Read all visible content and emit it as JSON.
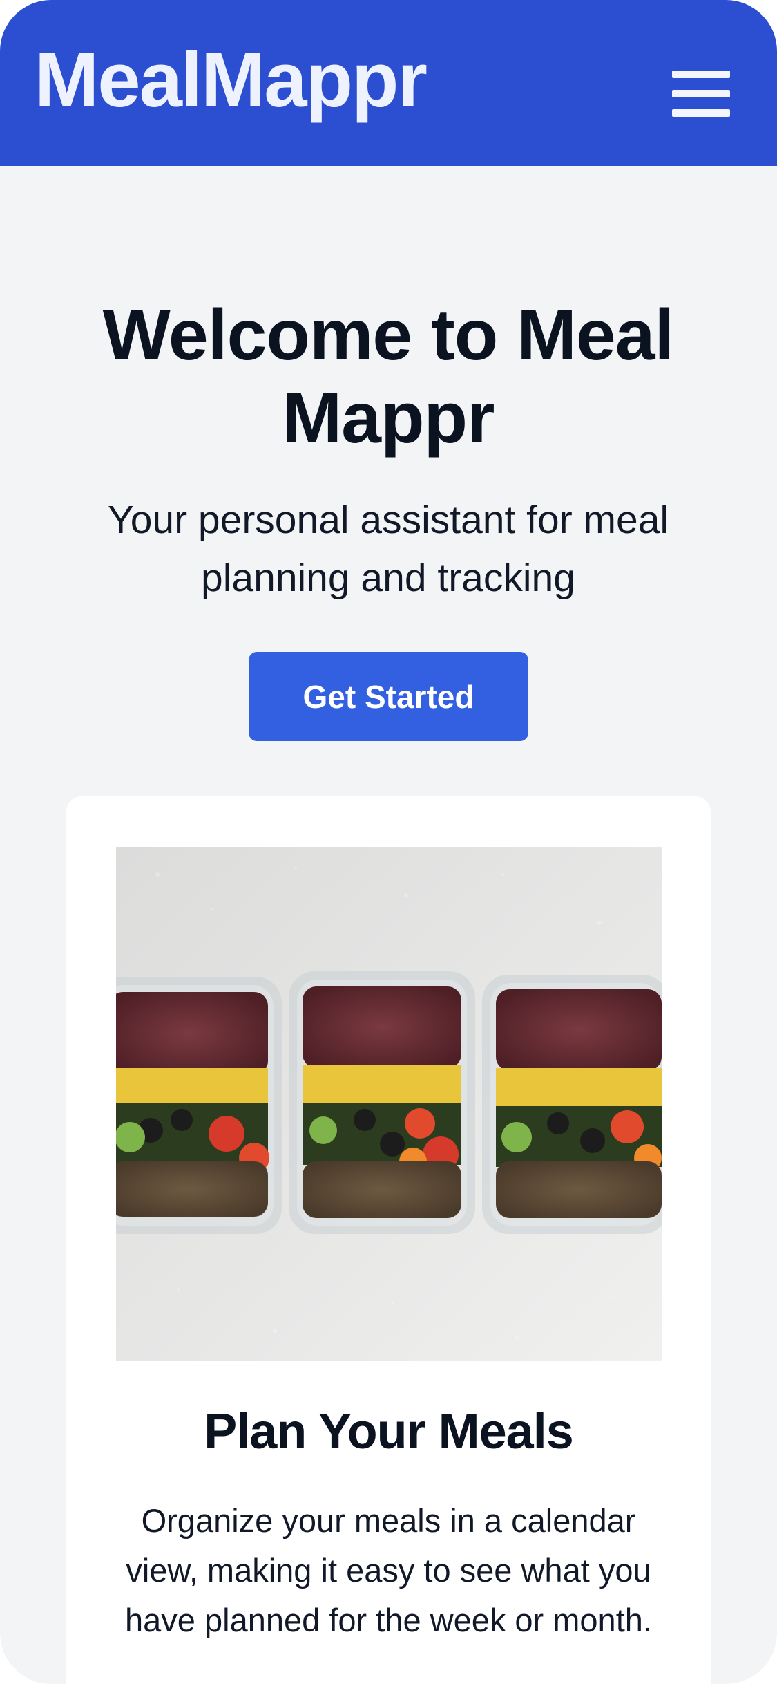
{
  "header": {
    "brand": "MealMappr",
    "menu_icon": "hamburger-menu-icon",
    "bg_color": "#2c4fd1"
  },
  "hero": {
    "title": "Welcome to Meal Mappr",
    "subtitle": "Your personal assistant for meal planning and tracking",
    "cta_label": "Get Started",
    "cta_color": "#3360e0"
  },
  "features": [
    {
      "image": "meal-prep-containers-photo",
      "title": "Plan Your Meals",
      "description": "Organize your meals in a calendar view, making it easy to see what you have planned for the week or month."
    }
  ],
  "colors": {
    "page_bg": "#f3f4f6",
    "text_primary": "#0b1220"
  }
}
